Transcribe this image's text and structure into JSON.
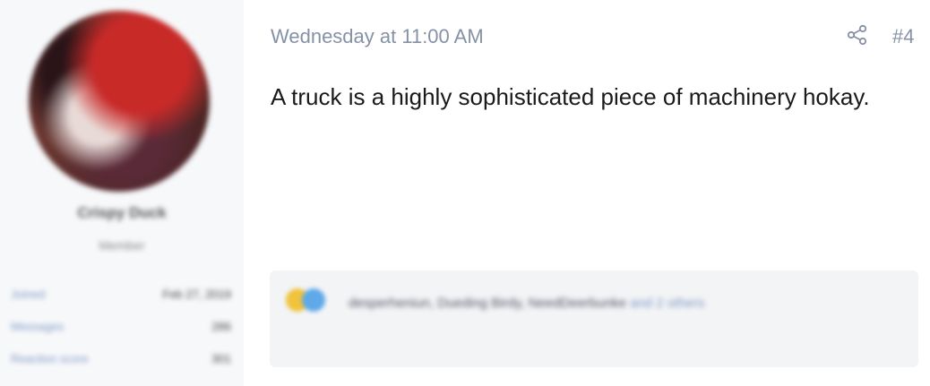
{
  "post": {
    "date": "Wednesday at 11:00 AM",
    "number": "#4",
    "body": "A truck is a highly sophisticated piece of machinery hokay."
  },
  "author": {
    "username": "Crispy Duck",
    "title": "Member",
    "stats": [
      {
        "label": "Joined",
        "value": "Feb 27, 2019"
      },
      {
        "label": "Messages",
        "value": "286"
      },
      {
        "label": "Reaction score",
        "value": "301"
      }
    ]
  },
  "reactions": {
    "users": "desperheniun, Dueding Birdy, NeedDeerbunke",
    "more": "and 2 others"
  },
  "colors": {
    "meta_text": "#8592a6",
    "sidebar_bg": "#f7f8fa",
    "reaction_bar_bg": "#f3f4f6",
    "link_blue": "#7d99c4"
  },
  "icons": {
    "share": "share-icon",
    "reaction_like": "haha-reaction-icon",
    "reaction_other": "blue-reaction-icon"
  }
}
